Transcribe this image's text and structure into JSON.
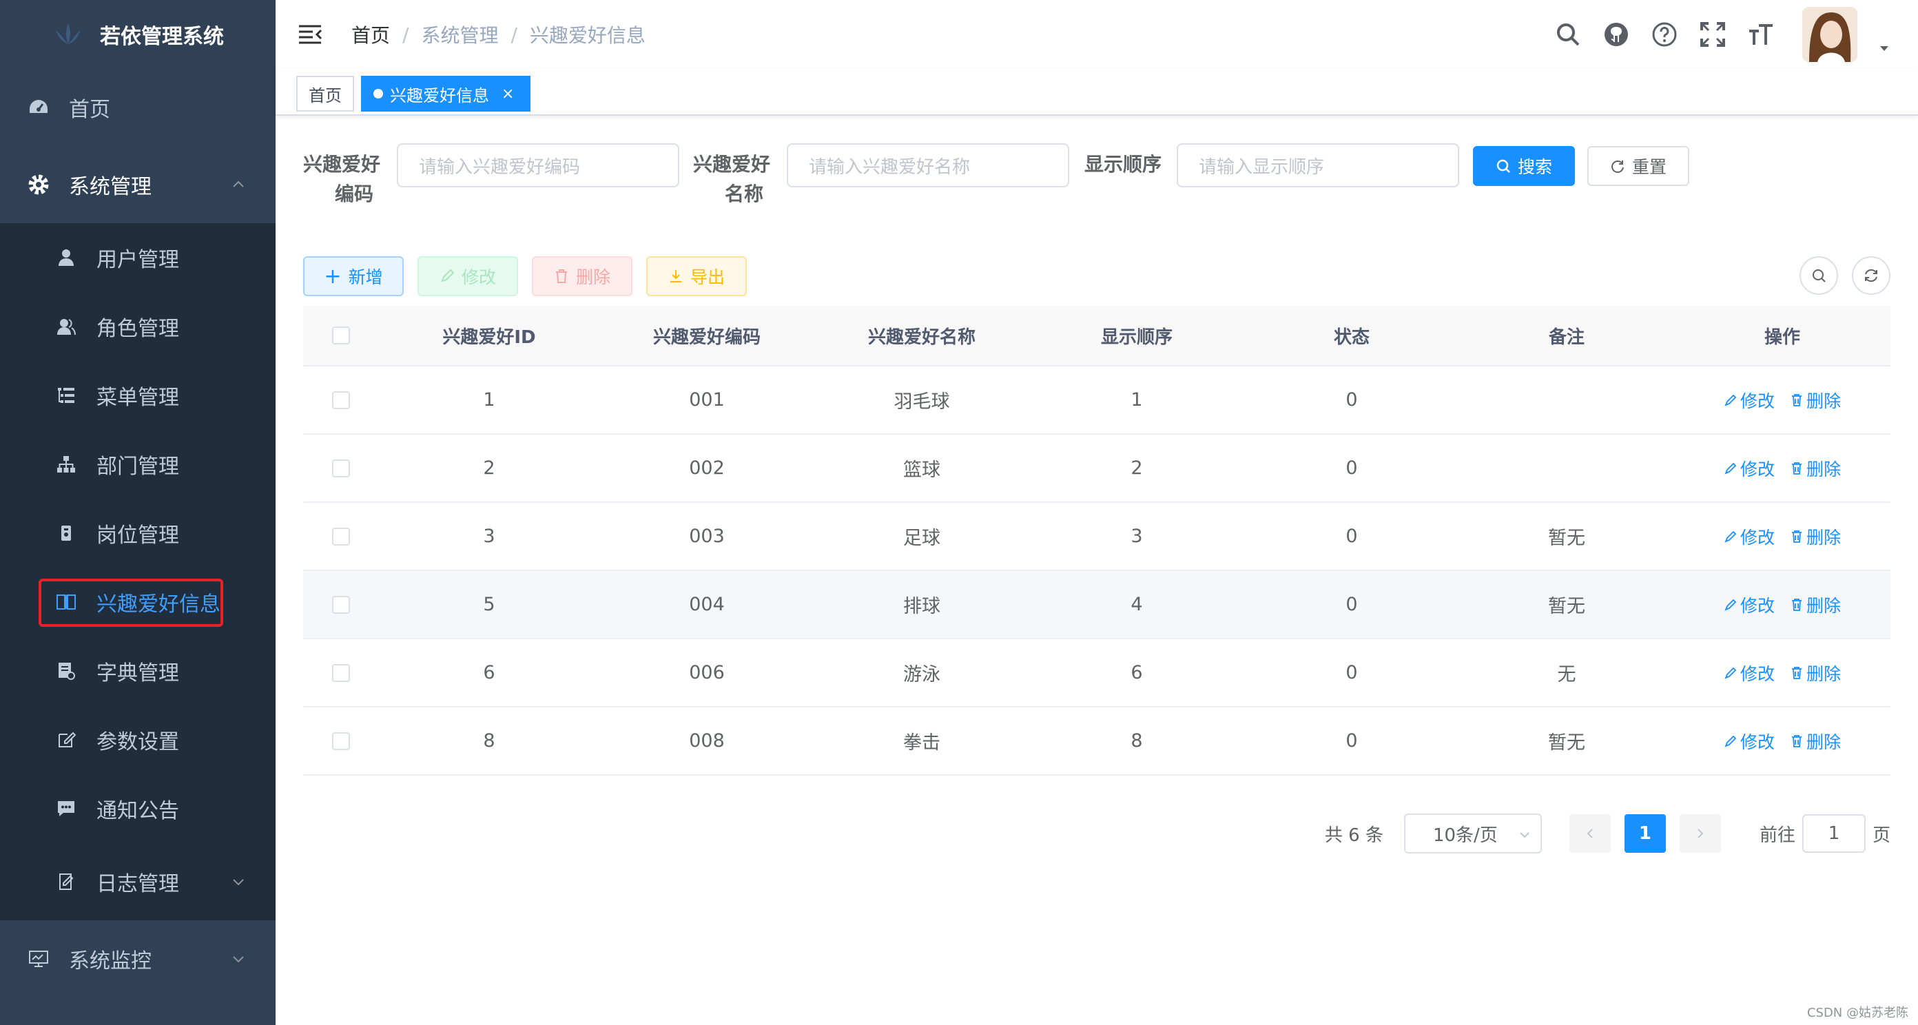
{
  "app": {
    "title": "若依管理系统"
  },
  "sidebar": {
    "home": "首页",
    "system": "系统管理",
    "sub_items": [
      {
        "label": "用户管理",
        "icon": "user-icon"
      },
      {
        "label": "角色管理",
        "icon": "peoples-icon"
      },
      {
        "label": "菜单管理",
        "icon": "tree-table-icon"
      },
      {
        "label": "部门管理",
        "icon": "tree-icon"
      },
      {
        "label": "岗位管理",
        "icon": "post-icon"
      },
      {
        "label": "兴趣爱好信息",
        "icon": "book-icon",
        "active": true
      },
      {
        "label": "字典管理",
        "icon": "dict-icon"
      },
      {
        "label": "参数设置",
        "icon": "edit-icon"
      },
      {
        "label": "通知公告",
        "icon": "message-icon"
      },
      {
        "label": "日志管理",
        "icon": "log-icon"
      }
    ],
    "monitor": "系统监控"
  },
  "navbar": {
    "breadcrumb": [
      "首页",
      "系统管理",
      "兴趣爱好信息"
    ],
    "separator": "/"
  },
  "tags": {
    "home": "首页",
    "current": "兴趣爱好信息",
    "close": "×"
  },
  "search": {
    "code_label_1": "兴趣爱好",
    "code_label_2": "编码",
    "code_placeholder": "请输入兴趣爱好编码",
    "name_label_1": "兴趣爱好",
    "name_label_2": "名称",
    "name_placeholder": "请输入兴趣爱好名称",
    "sort_label": "显示顺序",
    "sort_placeholder": "请输入显示顺序",
    "search_btn": "搜索",
    "reset_btn": "重置"
  },
  "toolbar": {
    "add": "新增",
    "edit": "修改",
    "delete": "删除",
    "export": "导出"
  },
  "table": {
    "headers": [
      "兴趣爱好ID",
      "兴趣爱好编码",
      "兴趣爱好名称",
      "显示顺序",
      "状态",
      "备注",
      "操作"
    ],
    "rows": [
      {
        "id": "1",
        "code": "001",
        "name": "羽毛球",
        "sort": "1",
        "status": "0",
        "remark": ""
      },
      {
        "id": "2",
        "code": "002",
        "name": "篮球",
        "sort": "2",
        "status": "0",
        "remark": ""
      },
      {
        "id": "3",
        "code": "003",
        "name": "足球",
        "sort": "3",
        "status": "0",
        "remark": "暂无"
      },
      {
        "id": "5",
        "code": "004",
        "name": "排球",
        "sort": "4",
        "status": "0",
        "remark": "暂无"
      },
      {
        "id": "6",
        "code": "006",
        "name": "游泳",
        "sort": "6",
        "status": "0",
        "remark": "无"
      },
      {
        "id": "8",
        "code": "008",
        "name": "拳击",
        "sort": "8",
        "status": "0",
        "remark": "暂无"
      }
    ],
    "op_edit": "修改",
    "op_delete": "删除"
  },
  "pagination": {
    "total": "共 6 条",
    "page_size": "10条/页",
    "current_page": "1",
    "goto_label": "前往",
    "goto_value": "1",
    "page_suffix": "页"
  },
  "watermark": "CSDN @姑苏老陈",
  "colors": {
    "primary": "#1890ff",
    "sidebar_bg": "#304156",
    "submenu_bg": "#1f2d3d",
    "highlight_box": "#e6212a"
  }
}
